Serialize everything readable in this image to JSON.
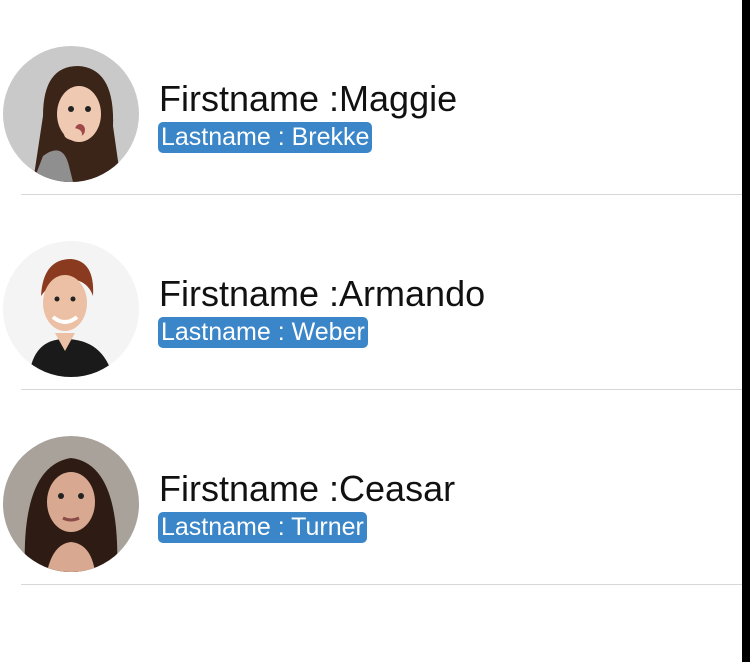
{
  "contacts": [
    {
      "firstname_line": "Firstname :Maggie",
      "lastname_line": "Lastname : Brekke",
      "avatar_icon": "woman-portrait-surprised"
    },
    {
      "firstname_line": "Firstname :Armando",
      "lastname_line": "Lastname : Weber",
      "avatar_icon": "woman-portrait-smiling"
    },
    {
      "firstname_line": "Firstname :Ceasar",
      "lastname_line": "Lastname : Turner",
      "avatar_icon": "woman-portrait-dark-hair"
    }
  ],
  "colors": {
    "lastname_badge": "#3a86c8",
    "divider": "#d8d8d8"
  }
}
